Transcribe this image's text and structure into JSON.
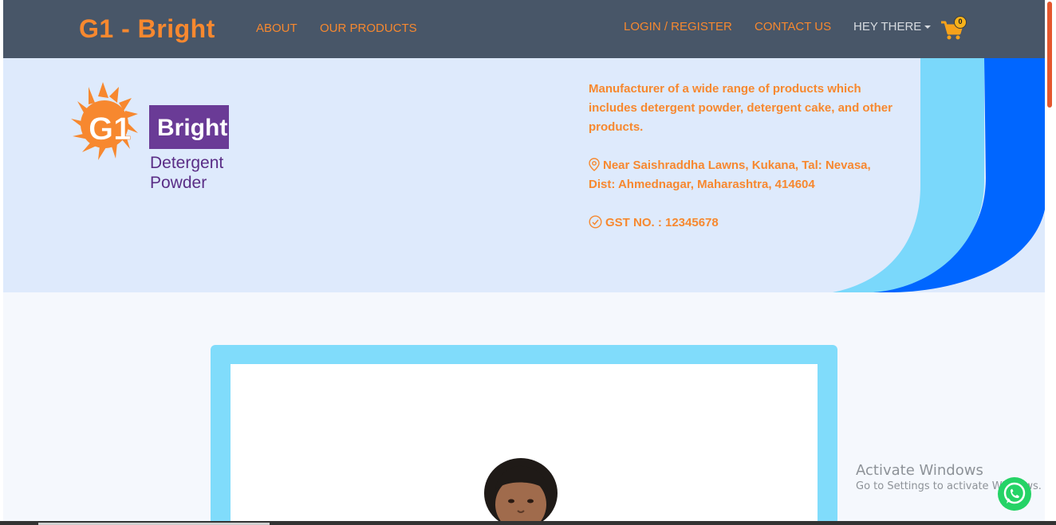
{
  "nav": {
    "brand": "G1 - Bright",
    "about": "ABOUT",
    "products": "OUR PRODUCTS",
    "login": "LOGIN / REGISTER",
    "contact": "CONTACT US",
    "greeting": "HEY THERE",
    "cart_count": "0"
  },
  "logo": {
    "mark": "G1",
    "word": "Bright",
    "line1": "Detergent",
    "line2": "Powder"
  },
  "header": {
    "description": "Manufacturer of a wide range of products which includes detergent powder, detergent cake, and other products.",
    "address": "Near Saishraddha Lawns, Kukana, Tal: Nevasa, Dist: Ahmednagar, Maharashtra, 414604",
    "gst": "GST NO. : 12345678"
  },
  "os_overlay": {
    "activate_title": "Activate Windows",
    "activate_sub": "Go to Settings to activate Windows."
  },
  "colors": {
    "navbar": "#485668",
    "accent": "#f7882f",
    "header_bg": "#deeafc",
    "wave_light": "#7ad8fb",
    "wave_dark": "#0066ff",
    "card_border": "#80dcfb"
  },
  "icons": [
    "cart-icon",
    "location-pin-icon",
    "check-circle-icon",
    "whatsapp-icon",
    "caret-down-icon"
  ]
}
